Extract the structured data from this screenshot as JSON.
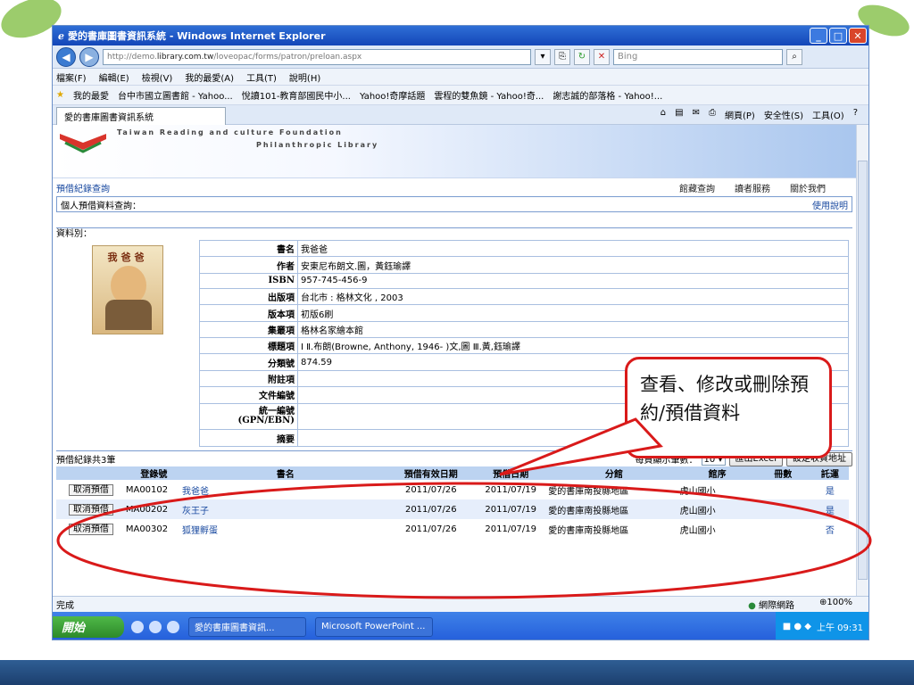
{
  "window": {
    "title": "愛的書庫圖書資訊系統 - Windows Internet Explorer",
    "minimize": "_",
    "maximize": "□",
    "close": "✕"
  },
  "address": {
    "url_prefix": "http://demo.",
    "url_domain": "library.com.tw",
    "url_path": "/loveopac/forms/patron/preloan.aspx",
    "search_placeholder": "Bing"
  },
  "menu": [
    "檔案(F)",
    "編輯(E)",
    "檢視(V)",
    "我的最愛(A)",
    "工具(T)",
    "說明(H)"
  ],
  "favorites": {
    "label": "我的最愛",
    "items": [
      "台中市國立圖書館 - Yahoo...",
      "悅讀101-教育部國民中小...",
      "Yahoo!奇摩話題",
      "雲程的雙魚鏡 - Yahoo!奇...",
      "謝志誠的部落格 - Yahoo!..."
    ]
  },
  "tab": {
    "label": "愛的書庫圖書資訊系統",
    "tools": [
      "網頁(P)",
      "安全性(S)",
      "工具(O)"
    ]
  },
  "banner": {
    "line1": "Taiwan Reading and culture Foundation",
    "line2": "Philanthropic Library"
  },
  "nav": {
    "current": "預借紀錄查詢",
    "links": [
      "館藏查詢",
      "讀者服務",
      "關於我們"
    ]
  },
  "section": {
    "title": "個人預借資料查詢：",
    "help": "使用說明"
  },
  "type_label": "資料別：",
  "cover_title": "我爸爸",
  "book": [
    {
      "label": "書名",
      "value": "我爸爸"
    },
    {
      "label": "作者",
      "value": "安東尼布朗文.圖，黃鈺瑜譯"
    },
    {
      "label": "ISBN",
      "value": "957-745-456-9"
    },
    {
      "label": "出版項",
      "value": "台北市 : 格林文化 , 2003"
    },
    {
      "label": "版本項",
      "value": "初版6刷"
    },
    {
      "label": "集叢項",
      "value": "格林名家繪本館"
    },
    {
      "label": "標題項",
      "value": "Ⅰ Ⅱ.布朗(Browne, Anthony, 1946- )文,圖 Ⅲ.黃,鈺瑜譯"
    },
    {
      "label": "分類號",
      "value": "874.59"
    },
    {
      "label": "附註項",
      "value": ""
    },
    {
      "label": "文件編號",
      "value": ""
    },
    {
      "label": "統一編號\n(GPN/EBN)",
      "value": ""
    },
    {
      "label": "摘要",
      "value": ""
    }
  ],
  "records": {
    "count_text": "預借紀錄共3筆",
    "per_page_label": "每頁顯示筆數：",
    "per_page_value": "10",
    "export_button": "匯出Excel",
    "address_button": "設定收貨地址",
    "columns": [
      "登錄號",
      "書名",
      "預借有效日期",
      "預借日期",
      "分館",
      "館序",
      "冊數",
      "託運"
    ],
    "cancel_label": "取消預借",
    "rows": [
      {
        "id": "MA00102",
        "title": "我爸爸",
        "valid": "2011/07/26",
        "date": "2011/07/19",
        "branch": "愛的書庫南投縣地區",
        "school": "虎山國小",
        "qty": "",
        "ship": "是"
      },
      {
        "id": "MA00202",
        "title": "灰王子",
        "valid": "2011/07/26",
        "date": "2011/07/19",
        "branch": "愛的書庫南投縣地區",
        "school": "虎山國小",
        "qty": "",
        "ship": "是"
      },
      {
        "id": "MA00302",
        "title": "狐狸孵蛋",
        "valid": "2011/07/26",
        "date": "2011/07/19",
        "branch": "愛的書庫南投縣地區",
        "school": "虎山國小",
        "qty": "",
        "ship": "否"
      }
    ]
  },
  "callout": {
    "text": "查看、修改或刪除預約/預借資料"
  },
  "status": {
    "left": "完成",
    "zone": "網際網路",
    "zoom": "100%"
  },
  "taskbar": {
    "start": "開始",
    "task1": "愛的書庫圖書資訊...",
    "task2": "Microsoft PowerPoint ...",
    "clock": "上午 09:31"
  },
  "colors": {
    "accent": "#1a4aa0",
    "highlight": "#d91a1a",
    "row_alt": "#e6eefb"
  }
}
